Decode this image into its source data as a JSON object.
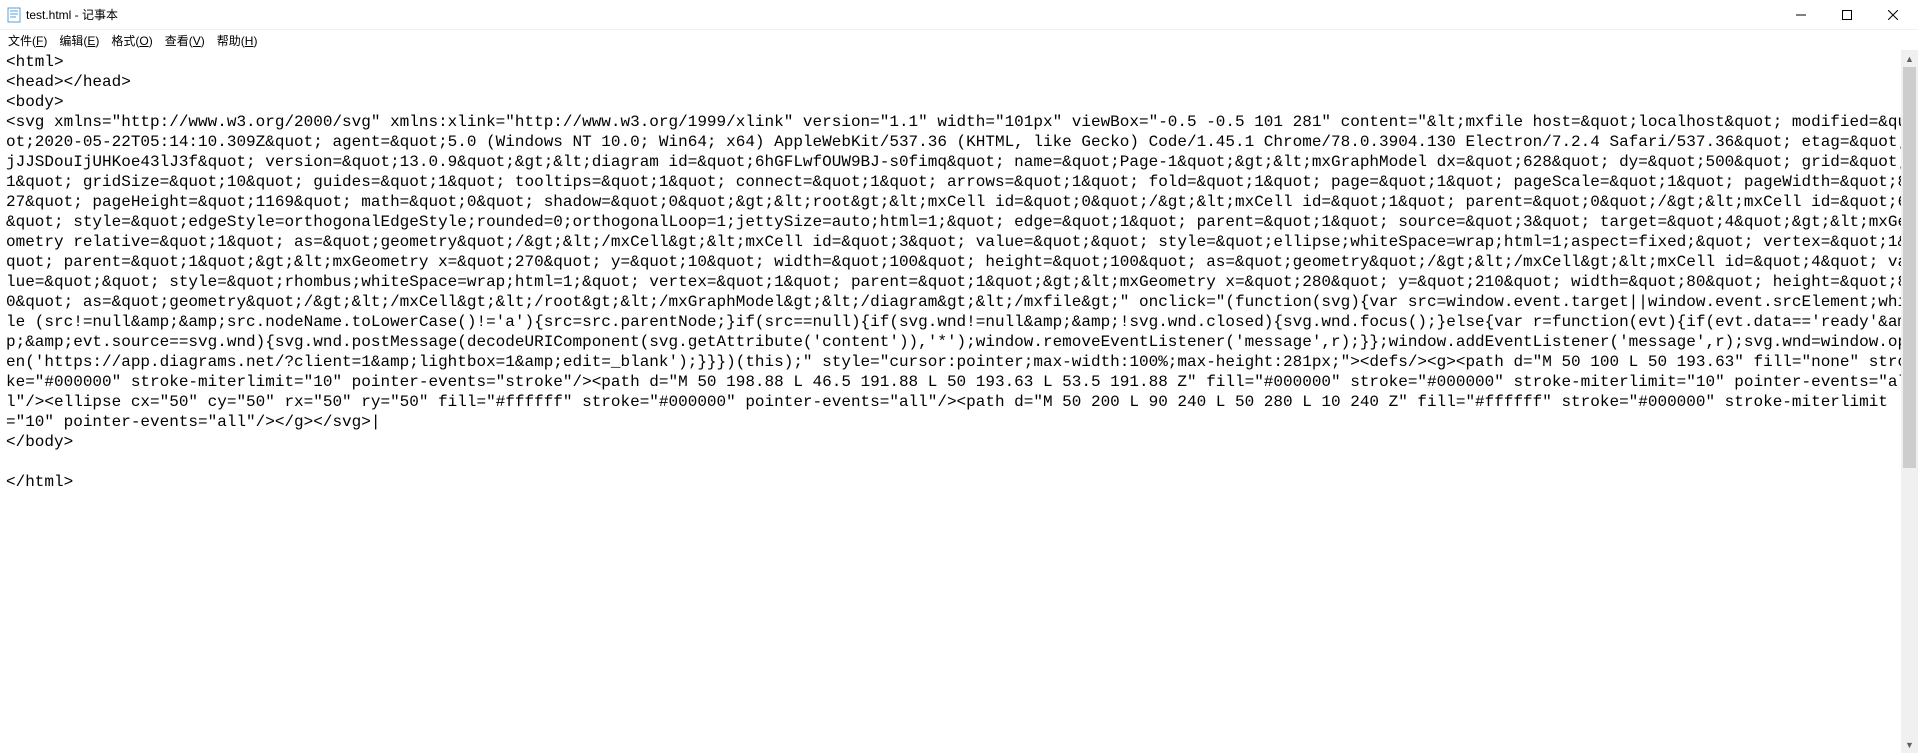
{
  "window": {
    "title": "test.html - 记事本"
  },
  "menu": {
    "file": {
      "label": "文件",
      "accel": "F"
    },
    "edit": {
      "label": "编辑",
      "accel": "E"
    },
    "format": {
      "label": "格式",
      "accel": "O"
    },
    "view": {
      "label": "查看",
      "accel": "V"
    },
    "help": {
      "label": "帮助",
      "accel": "H"
    }
  },
  "content": {
    "text": "<html>\n<head></head>\n<body>\n<svg xmlns=\"http://www.w3.org/2000/svg\" xmlns:xlink=\"http://www.w3.org/1999/xlink\" version=\"1.1\" width=\"101px\" viewBox=\"-0.5 -0.5 101 281\" content=\"&lt;mxfile host=&quot;localhost&quot; modified=&quot;2020-05-22T05:14:10.309Z&quot; agent=&quot;5.0 (Windows NT 10.0; Win64; x64) AppleWebKit/537.36 (KHTML, like Gecko) Code/1.45.1 Chrome/78.0.3904.130 Electron/7.2.4 Safari/537.36&quot; etag=&quot;jJJSDouIjUHKoe43lJ3f&quot; version=&quot;13.0.9&quot;&gt;&lt;diagram id=&quot;6hGFLwfOUW9BJ-s0fimq&quot; name=&quot;Page-1&quot;&gt;&lt;mxGraphModel dx=&quot;628&quot; dy=&quot;500&quot; grid=&quot;1&quot; gridSize=&quot;10&quot; guides=&quot;1&quot; tooltips=&quot;1&quot; connect=&quot;1&quot; arrows=&quot;1&quot; fold=&quot;1&quot; page=&quot;1&quot; pageScale=&quot;1&quot; pageWidth=&quot;827&quot; pageHeight=&quot;1169&quot; math=&quot;0&quot; shadow=&quot;0&quot;&gt;&lt;root&gt;&lt;mxCell id=&quot;0&quot;/&gt;&lt;mxCell id=&quot;1&quot; parent=&quot;0&quot;/&gt;&lt;mxCell id=&quot;6&quot; style=&quot;edgeStyle=orthogonalEdgeStyle;rounded=0;orthogonalLoop=1;jettySize=auto;html=1;&quot; edge=&quot;1&quot; parent=&quot;1&quot; source=&quot;3&quot; target=&quot;4&quot;&gt;&lt;mxGeometry relative=&quot;1&quot; as=&quot;geometry&quot;/&gt;&lt;/mxCell&gt;&lt;mxCell id=&quot;3&quot; value=&quot;&quot; style=&quot;ellipse;whiteSpace=wrap;html=1;aspect=fixed;&quot; vertex=&quot;1&quot; parent=&quot;1&quot;&gt;&lt;mxGeometry x=&quot;270&quot; y=&quot;10&quot; width=&quot;100&quot; height=&quot;100&quot; as=&quot;geometry&quot;/&gt;&lt;/mxCell&gt;&lt;mxCell id=&quot;4&quot; value=&quot;&quot; style=&quot;rhombus;whiteSpace=wrap;html=1;&quot; vertex=&quot;1&quot; parent=&quot;1&quot;&gt;&lt;mxGeometry x=&quot;280&quot; y=&quot;210&quot; width=&quot;80&quot; height=&quot;80&quot; as=&quot;geometry&quot;/&gt;&lt;/mxCell&gt;&lt;/root&gt;&lt;/mxGraphModel&gt;&lt;/diagram&gt;&lt;/mxfile&gt;\" onclick=\"(function(svg){var src=window.event.target||window.event.srcElement;while (src!=null&amp;&amp;src.nodeName.toLowerCase()!='a'){src=src.parentNode;}if(src==null){if(svg.wnd!=null&amp;&amp;!svg.wnd.closed){svg.wnd.focus();}else{var r=function(evt){if(evt.data=='ready'&amp;&amp;evt.source==svg.wnd){svg.wnd.postMessage(decodeURIComponent(svg.getAttribute('content')),'*');window.removeEventListener('message',r);}};window.addEventListener('message',r);svg.wnd=window.open('https://app.diagrams.net/?client=1&amp;lightbox=1&amp;edit=_blank');}}})(this);\" style=\"cursor:pointer;max-width:100%;max-height:281px;\"><defs/><g><path d=\"M 50 100 L 50 193.63\" fill=\"none\" stroke=\"#000000\" stroke-miterlimit=\"10\" pointer-events=\"stroke\"/><path d=\"M 50 198.88 L 46.5 191.88 L 50 193.63 L 53.5 191.88 Z\" fill=\"#000000\" stroke=\"#000000\" stroke-miterlimit=\"10\" pointer-events=\"all\"/><ellipse cx=\"50\" cy=\"50\" rx=\"50\" ry=\"50\" fill=\"#ffffff\" stroke=\"#000000\" pointer-events=\"all\"/><path d=\"M 50 200 L 90 240 L 50 280 L 10 240 Z\" fill=\"#ffffff\" stroke=\"#000000\" stroke-miterlimit=\"10\" pointer-events=\"all\"/></g></svg>|\n</body>\n\n</html>"
  }
}
